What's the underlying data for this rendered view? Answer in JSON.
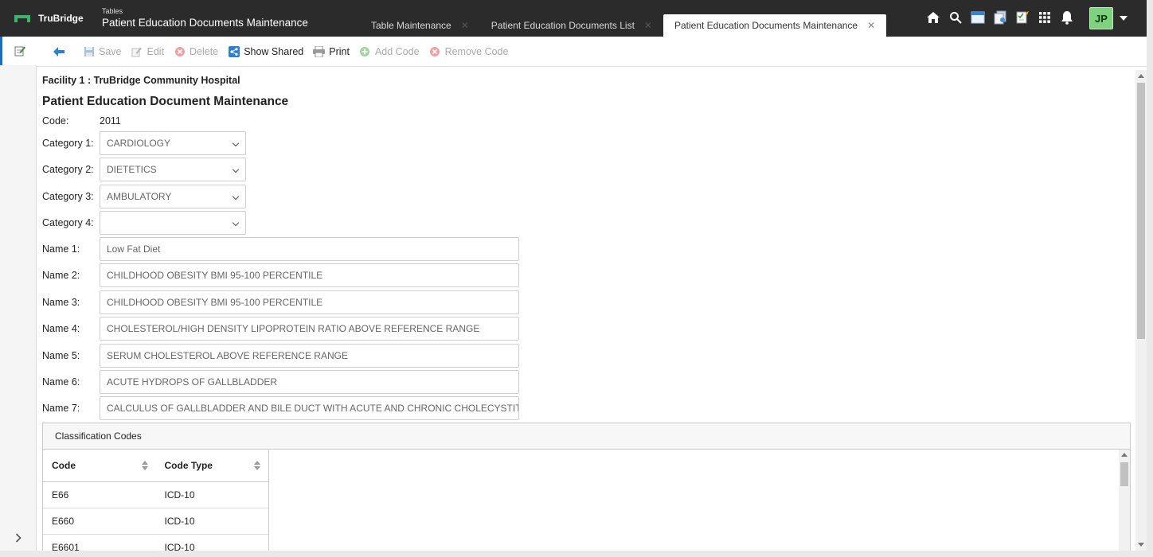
{
  "brand": {
    "name": "TruBridge",
    "logo_color": "#3db36b"
  },
  "app": {
    "subtitle": "Tables",
    "title": "Patient Education Documents Maintenance"
  },
  "tabs": [
    {
      "label": "Table Maintenance",
      "active": false
    },
    {
      "label": "Patient Education Documents List",
      "active": false
    },
    {
      "label": "Patient Education Documents Maintenance",
      "active": true
    }
  ],
  "top_icons": [
    "home-icon",
    "search-icon",
    "calendar-icon",
    "documents-icon",
    "checklist-icon",
    "apps-grid-icon",
    "bell-icon"
  ],
  "user": {
    "initials": "JP",
    "avatar_color": "#7ed17e"
  },
  "toolbar": {
    "back_icon": "back-arrow-icon",
    "save": "Save",
    "edit": "Edit",
    "delete": "Delete",
    "show_shared": "Show Shared",
    "print": "Print",
    "add_code": "Add Code",
    "remove_code": "Remove Code"
  },
  "facility": "Facility 1 : TruBridge Community Hospital",
  "page_title": "Patient Education Document Maintenance",
  "code": {
    "label": "Code:",
    "value": "2011"
  },
  "categories": [
    {
      "label": "Category 1:",
      "value": "CARDIOLOGY"
    },
    {
      "label": "Category 2:",
      "value": "DIETETICS"
    },
    {
      "label": "Category 3:",
      "value": "AMBULATORY"
    },
    {
      "label": "Category 4:",
      "value": ""
    }
  ],
  "names": [
    {
      "label": "Name 1:",
      "value": "Low Fat Diet"
    },
    {
      "label": "Name 2:",
      "value": "CHILDHOOD OBESITY BMI 95-100 PERCENTILE"
    },
    {
      "label": "Name 3:",
      "value": "CHILDHOOD OBESITY BMI 95-100 PERCENTILE"
    },
    {
      "label": "Name 4:",
      "value": "CHOLESTEROL/HIGH DENSITY LIPOPROTEIN RATIO ABOVE REFERENCE RANGE"
    },
    {
      "label": "Name 5:",
      "value": "SERUM CHOLESTEROL ABOVE REFERENCE RANGE"
    },
    {
      "label": "Name 6:",
      "value": "ACUTE HYDROPS OF GALLBLADDER"
    },
    {
      "label": "Name 7:",
      "value": "CALCULUS OF GALLBLADDER AND BILE DUCT WITH ACUTE AND CHRONIC CHOLECYSTITIS"
    }
  ],
  "classification": {
    "title": "Classification Codes",
    "columns": [
      "Code",
      "Code Type"
    ],
    "rows": [
      [
        "E66",
        "ICD-10"
      ],
      [
        "E660",
        "ICD-10"
      ],
      [
        "E6601",
        "ICD-10"
      ]
    ]
  }
}
